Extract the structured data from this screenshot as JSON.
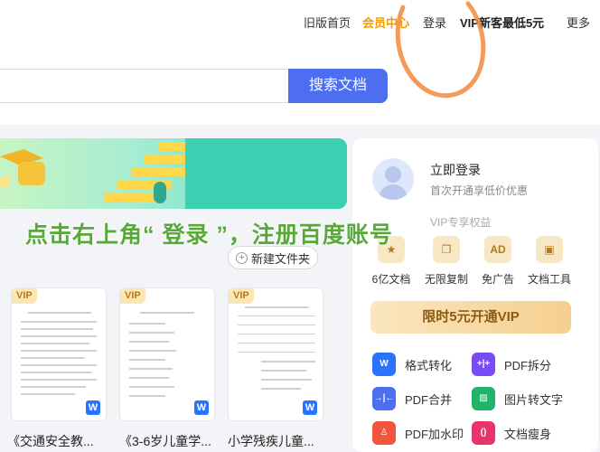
{
  "nav": {
    "old_home": "旧版首页",
    "vip_center": "会员中心",
    "login": "登录",
    "promo": "VIP新客最低5元",
    "more": "更多"
  },
  "search": {
    "button_label": "搜索文档",
    "value": ""
  },
  "files": {
    "new_folder": "新建文件夹",
    "cards": [
      {
        "tag": "VIP",
        "title": "《交通安全教..."
      },
      {
        "tag": "VIP",
        "title": "《3-6岁儿童学..."
      },
      {
        "tag": "VIP",
        "title": "小学残疾儿童..."
      }
    ],
    "word_badge": "W"
  },
  "panel": {
    "login_title": "立即登录",
    "login_sub": "首次开通享低价优惠",
    "vip_benefit": "VIP专享权益",
    "features": [
      {
        "label": "6亿文档",
        "icon": "star-icon",
        "glyph": "★"
      },
      {
        "label": "无限复制",
        "icon": "copy-icon",
        "glyph": "❐"
      },
      {
        "label": "免广告",
        "icon": "ad-icon",
        "glyph": "AD"
      },
      {
        "label": "文档工具",
        "icon": "toolbox-icon",
        "glyph": "▣"
      }
    ],
    "vip_button": "限时5元开通VIP",
    "tools": [
      {
        "label": "格式转化",
        "icon": "word-convert-icon",
        "glyph": "W",
        "color": "#2a73ff"
      },
      {
        "label": "PDF拆分",
        "icon": "pdf-split-icon",
        "glyph": "+|+",
        "color": "#7b4cf5"
      },
      {
        "label": "PDF合并",
        "icon": "pdf-merge-icon",
        "glyph": "→|←",
        "color": "#4e6ef2"
      },
      {
        "label": "图片转文字",
        "icon": "image-to-text-icon",
        "glyph": "▨",
        "color": "#22b36a"
      },
      {
        "label": "PDF加水印",
        "icon": "pdf-watermark-icon",
        "glyph": "♙",
        "color": "#f3553c"
      },
      {
        "label": "文档瘦身",
        "icon": "doc-slim-icon",
        "glyph": "()",
        "color": "#e8346a"
      }
    ]
  },
  "overlay": {
    "caption": "点击右上角“ 登录 ”，注册百度账号"
  },
  "colors": {
    "accent": "#4e6ef2",
    "vip": "#f29b00",
    "caption": "#59a83a",
    "scribble": "#f28a3d"
  }
}
